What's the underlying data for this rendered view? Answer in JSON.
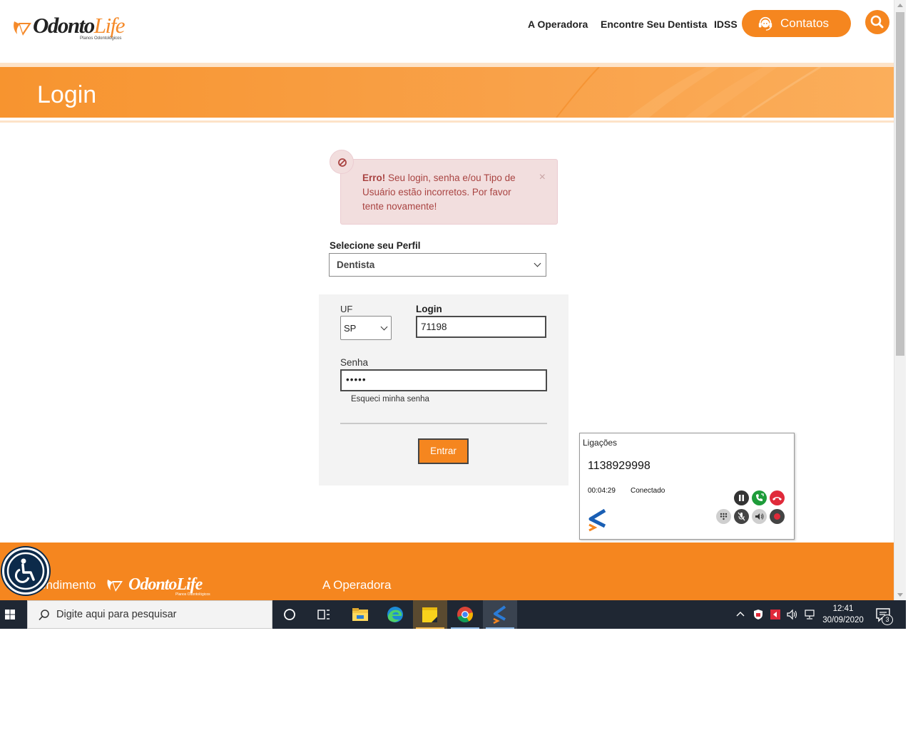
{
  "header": {
    "logo_text_a": "Odonto",
    "logo_text_b": "Life",
    "logo_sub": "Planos Odontológicos",
    "nav": [
      "A Operadora",
      "Encontre Seu Dentista",
      "IDSS"
    ],
    "contatos_label": "Contatos"
  },
  "banner": {
    "title": "Login"
  },
  "alert": {
    "strong": "Erro!",
    "message": " Seu login, senha e/ou Tipo de Usuário estão incorretos. Por favor tente novamente!",
    "close": "×"
  },
  "form": {
    "perfil_label": "Selecione seu Perfil",
    "perfil_value": "Dentista",
    "uf_label": "UF",
    "uf_value": "SP",
    "login_label": "Login",
    "login_value": "71198",
    "senha_label": "Senha",
    "senha_value": "•••••",
    "forgot_label": "Esqueci minha senha",
    "submit_label": "Entrar"
  },
  "call_widget": {
    "title": "Ligações",
    "number": "1138929998",
    "duration": "00:04:29",
    "status": "Conectado"
  },
  "footer": {
    "atendimento": "endimento",
    "logo_text": "OdontoLife",
    "logo_sub": "Planos Odontológicos",
    "operadora": "A Operadora"
  },
  "taskbar": {
    "search_placeholder": "Digite aqui para pesquisar",
    "time": "12:41",
    "date": "30/09/2020",
    "notification_count": "3"
  },
  "colors": {
    "brand_orange": "#f5861f",
    "alert_bg": "#f2dede",
    "alert_text": "#a94442",
    "taskbar": "#1f2733"
  }
}
